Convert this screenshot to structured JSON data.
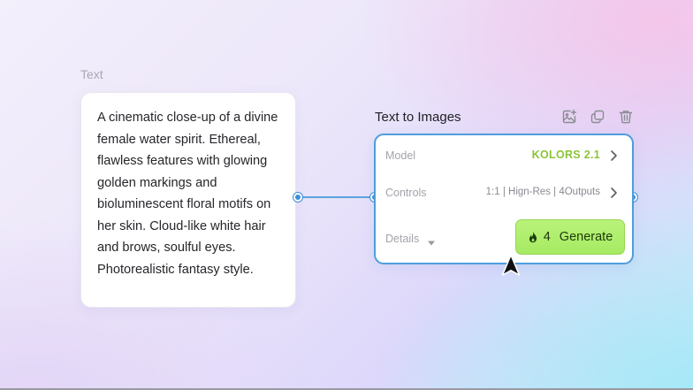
{
  "text_node": {
    "label": "Text",
    "prompt": "A cinematic close-up of a divine female water spirit. Ethereal, flawless features with glowing golden markings and bioluminescent floral motifs on her skin. Cloud-like white hair and brows, soulful eyes. Photorealistic fantasy style."
  },
  "t2i_node": {
    "title": "Text to Images",
    "toolbar_icons": [
      "add-image-icon",
      "duplicate-icon",
      "delete-icon"
    ],
    "model_label": "Model",
    "model_value": "KOLORS 2.1",
    "controls_label": "Controls",
    "controls_value": "1:1 | Hign-Res | 4Outputs",
    "details_label": "Details",
    "generate": {
      "credits": "4",
      "label": "Generate"
    }
  },
  "colors": {
    "accent_border": "#4f9ddd",
    "model_value": "#8bc43a",
    "generate_bg": "#a6ea62",
    "connector": "#5aa4dc"
  }
}
